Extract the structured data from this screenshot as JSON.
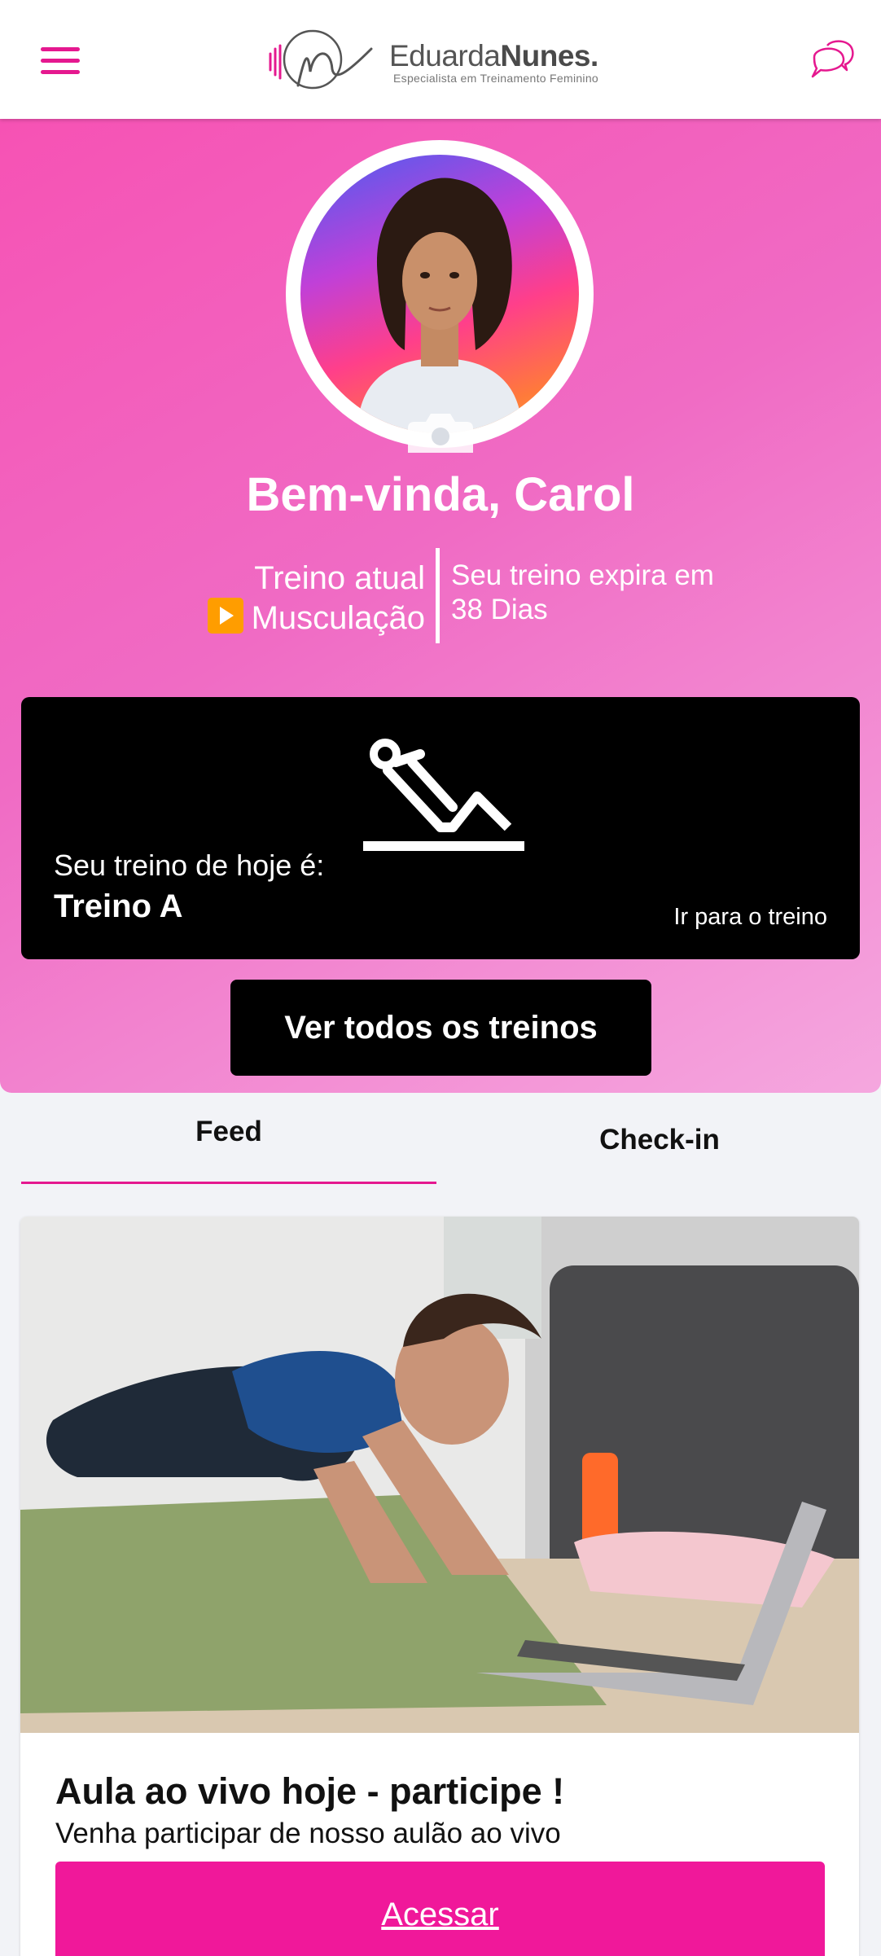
{
  "header": {
    "menu_icon": "hamburger-menu-icon",
    "logo": {
      "name_regular": "Eduarda",
      "name_bold": "Nunes.",
      "tagline": "Especialista em Treinamento Feminino"
    },
    "chat_icon": "chat-bubbles-icon",
    "accent_color": "#e5188f"
  },
  "hero": {
    "welcome": "Bem-vinda, Carol",
    "current_training_label": "Treino atual",
    "current_training_value": "Musculação",
    "current_training_icon": "play-button-icon",
    "expires_label": "Seu treino expira em",
    "expires_value": "38 Dias",
    "camera_icon": "camera-icon",
    "today": {
      "icon": "exercise-stretch-icon",
      "subtitle": "Seu treino de hoje é:",
      "name": "Treino A",
      "link": "Ir para o treino"
    },
    "all_workouts_button": "Ver todos os treinos",
    "gradient_colors": [
      "#f652b4",
      "#f5a7df"
    ]
  },
  "tabs": [
    {
      "label": "Feed",
      "active": true
    },
    {
      "label": "Check-in",
      "active": false
    }
  ],
  "feed": {
    "post": {
      "title": "Aula ao vivo hoje - participe !",
      "description": "Venha participar de nosso aulão ao vivo",
      "button": "Acessar",
      "button_color": "#f0189a"
    }
  }
}
